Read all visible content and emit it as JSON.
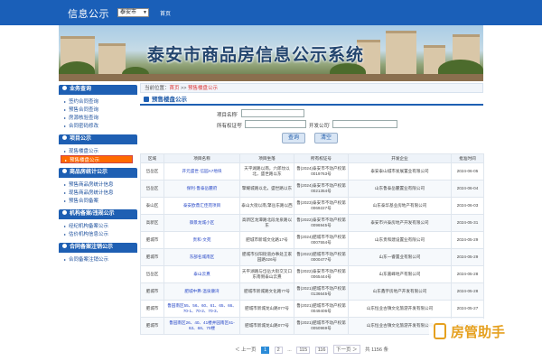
{
  "header": {
    "brand": "信息公示",
    "city_select": "泰安市",
    "home": "首页"
  },
  "banner": {
    "title": "泰安市商品房信息公示系统"
  },
  "sidebar": {
    "sections": [
      {
        "title": "业务查询",
        "items": [
          "签约合同查询",
          "预售合同查询",
          "房源核验查询",
          "合同密码修改"
        ]
      },
      {
        "title": "项目公示",
        "items": [
          "现售楼盘公示",
          "预售楼盘公示"
        ],
        "active_index": 1
      },
      {
        "title": "商品房统计公示",
        "items": [
          "预售商品房统计信息",
          "现售商品房统计信息",
          "预售合同备案"
        ]
      },
      {
        "title": "机构备案/违规公示",
        "items": [
          "经纪机构备案公示",
          "估价机构信息公示"
        ]
      },
      {
        "title": "合同备案注销公示",
        "items": [
          "合同备案注销公示"
        ]
      }
    ]
  },
  "breadcrumb": {
    "prefix": "当前位置：",
    "home": "首页",
    "sep": " >> ",
    "current": "预售楼盘公示"
  },
  "section_title": "预售楼盘公示",
  "search": {
    "project_label": "项目名称",
    "owner_label": "所有权证号",
    "developer_label": "开发公司",
    "query_button": "查询",
    "clear_button": "清空"
  },
  "table": {
    "columns": [
      "区域",
      "项目名称",
      "项目坐落",
      "所有权证号",
      "开发企业",
      "批准时间"
    ],
    "rows": [
      [
        "岱岳区",
        "开元盛世·信园A7地块",
        "天平湖路以南，六郎坟以北，盛世路以东",
        "鲁(2024)泰安市不动产权第0019763号",
        "泰安泰山城市发展置业有限公司",
        "2024-06-05"
      ],
      [
        "岱岳区",
        "保利·鲁泰岳麓府",
        "擎耀城路以北，盛世路以东",
        "鲁(2024)泰安市不动产权第0021354号",
        "山东鲁泰岳麓置业有限公司",
        "2024-06-04"
      ],
      [
        "泰山区",
        "泰安欧鼎汇佳苑项目",
        "泰山大街以南,擎岳东路以西",
        "鲁(2023)泰安市不动产权第0069227号",
        "山东泰华基业房地产有限公司",
        "2024-06-03"
      ],
      [
        "高新区",
        "御景龙城小区",
        "高新区龙潭路北段龙泉路以东",
        "鲁(2022)泰安市不动产权第0096945号",
        "泰安市兴泰房地产开发有限公司",
        "2024-05-31"
      ],
      [
        "肥城市",
        "贵和·文苑",
        "肥城市新城文化路17号",
        "鲁(2024)肥城市不动产权第0007554号",
        "山东贵和建设置业有限公司",
        "2024-05-29"
      ],
      [
        "肥城市",
        "东部名城南区",
        "肥城市仪阳街道办事处王家园路026号",
        "鲁(2022)肥城市不动产权第0000477号",
        "山东一睿置业有限公司",
        "2024-05-29"
      ],
      [
        "岱岳区",
        "泰山云熹",
        "天平湖路与岱岳大街交叉口东南侧泰山云熹",
        "鲁(2022)泰安市不动产权第0065444号",
        "山东嘉峰地产有限公司",
        "2024-05-28"
      ],
      [
        "肥城市",
        "肥城中弗·温泉康湾",
        "肥城市新城路文化路77号",
        "鲁(2021)肥城市不动产权第0136645号",
        "山东鑫宇房地产开发有限公司",
        "2024-05-28"
      ],
      [
        "肥城市",
        "鲁园南区55、56、60、61、65、66、70-1、70-2、70-3、",
        "肥城市新城龙山路077号",
        "鲁(2021)肥城市不动产权第0049406号",
        "山东恒业古镇文化旅游开发有限公司",
        "2024-05-27"
      ],
      [
        "肥城市",
        "鲁园南区26、40、41楼并园南区61-63、68、70楼",
        "肥城市新城龙山路077号",
        "鲁(2021)肥城市不动产权第0050969号",
        "山东恒业古镇文化旅游开发有限公司",
        "2024-05-27"
      ]
    ]
  },
  "pager": {
    "first": "＜ 上一页",
    "current": "1",
    "p2": "2",
    "ellipsis": "...",
    "p115": "115",
    "p116": "116",
    "next": "下一页 ＞",
    "total": "共 1156 条"
  },
  "watermark": {
    "text": "房管助手"
  }
}
